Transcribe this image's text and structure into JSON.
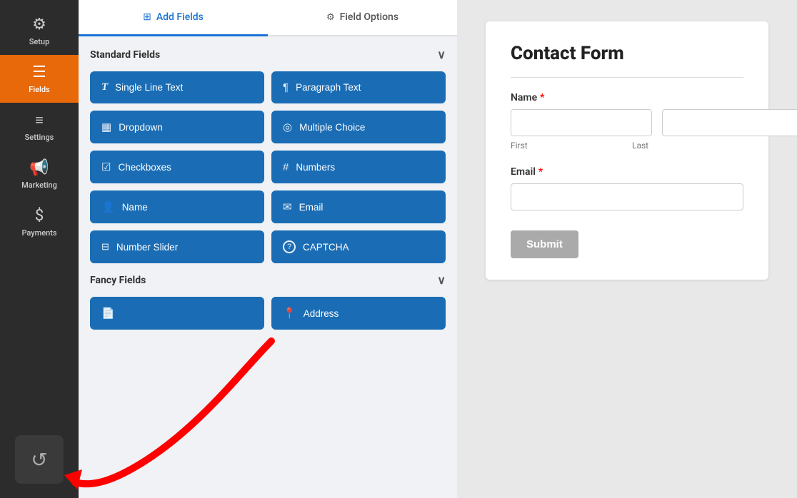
{
  "sidebar": {
    "items": [
      {
        "label": "Setup",
        "icon": "⚙",
        "active": false
      },
      {
        "label": "Fields",
        "icon": "☰",
        "active": true
      },
      {
        "label": "Settings",
        "icon": "⚙",
        "active": false
      },
      {
        "label": "Marketing",
        "icon": "📢",
        "active": false
      },
      {
        "label": "Payments",
        "icon": "$",
        "active": false
      }
    ],
    "undo_icon": "↺"
  },
  "tabs": [
    {
      "label": "Add Fields",
      "icon": "⊞",
      "active": true
    },
    {
      "label": "Field Options",
      "icon": "⚙",
      "active": false
    }
  ],
  "standard_fields": {
    "section_label": "Standard Fields",
    "buttons": [
      {
        "label": "Single Line Text",
        "icon": "T"
      },
      {
        "label": "Paragraph Text",
        "icon": "¶"
      },
      {
        "label": "Dropdown",
        "icon": "▦"
      },
      {
        "label": "Multiple Choice",
        "icon": "◎"
      },
      {
        "label": "Checkboxes",
        "icon": "☑"
      },
      {
        "label": "Numbers",
        "icon": "#"
      },
      {
        "label": "Name",
        "icon": "👤"
      },
      {
        "label": "Email",
        "icon": "✉"
      },
      {
        "label": "Number Slider",
        "icon": "⊟"
      },
      {
        "label": "CAPTCHA",
        "icon": "?"
      }
    ]
  },
  "fancy_fields": {
    "section_label": "Fancy Fields",
    "buttons": [
      {
        "label": "",
        "icon": "📄"
      },
      {
        "label": "Address",
        "icon": "📍"
      }
    ]
  },
  "form_preview": {
    "title": "Contact Form",
    "fields": [
      {
        "label": "Name",
        "required": true,
        "type": "name",
        "sub_labels": [
          "First",
          "Last"
        ]
      },
      {
        "label": "Email",
        "required": true,
        "type": "email"
      }
    ],
    "submit_label": "Submit"
  }
}
